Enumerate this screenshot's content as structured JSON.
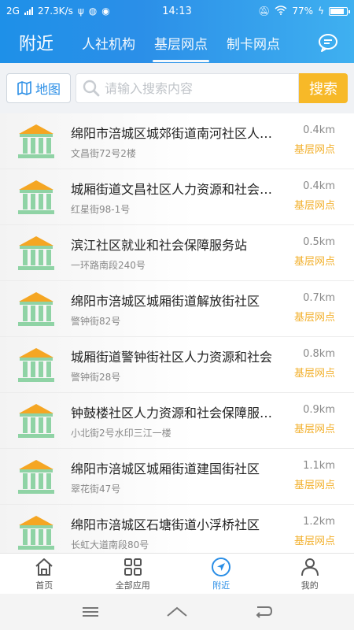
{
  "status_bar": {
    "network": "2G",
    "speed": "27.3K/s",
    "time": "14:13",
    "battery": "77%"
  },
  "header": {
    "title": "附近",
    "tabs": [
      {
        "label": "人社机构"
      },
      {
        "label": "基层网点"
      },
      {
        "label": "制卡网点"
      }
    ],
    "active_tab": 1
  },
  "search": {
    "map_label": "地图",
    "placeholder": "请输入搜索内容",
    "button_label": "搜索"
  },
  "list": [
    {
      "name": "绵阳市涪城区城郊街道南河社区人力资源",
      "address": "文昌街72号2楼",
      "distance": "0.4km",
      "type": "基层网点"
    },
    {
      "name": "城厢街道文昌社区人力资源和社会保障",
      "address": "红星街98-1号",
      "distance": "0.4km",
      "type": "基层网点"
    },
    {
      "name": "滨江社区就业和社会保障服务站",
      "address": "一环路南段240号",
      "distance": "0.5km",
      "type": "基层网点"
    },
    {
      "name": "绵阳市涪城区城厢街道解放街社区",
      "address": "警钟街82号",
      "distance": "0.7km",
      "type": "基层网点"
    },
    {
      "name": "城厢街道警钟街社区人力资源和社会",
      "address": "警钟街28号",
      "distance": "0.8km",
      "type": "基层网点"
    },
    {
      "name": "钟鼓楼社区人力资源和社会保障服务站",
      "address": "小北街2号水印三江一楼",
      "distance": "0.9km",
      "type": "基层网点"
    },
    {
      "name": "绵阳市涪城区城厢街道建国街社区",
      "address": "翠花街47号",
      "distance": "1.1km",
      "type": "基层网点"
    },
    {
      "name": "绵阳市涪城区石塘街道小浮桥社区",
      "address": "长虹大道南段80号",
      "distance": "1.2km",
      "type": "基层网点"
    }
  ],
  "bottom_nav": [
    {
      "label": "首页",
      "icon": "home-icon"
    },
    {
      "label": "全部应用",
      "icon": "apps-icon"
    },
    {
      "label": "附近",
      "icon": "location-arrow-icon"
    },
    {
      "label": "我的",
      "icon": "user-icon"
    }
  ],
  "active_nav": 2,
  "colors": {
    "header_start": "#1e90e8",
    "header_end": "#3fb0f0",
    "accent": "#2a8ee6",
    "search_button": "#f7b928",
    "type_label": "#f2b02c",
    "building_roof": "#f5a623",
    "building_body": "#8fd3a5"
  }
}
